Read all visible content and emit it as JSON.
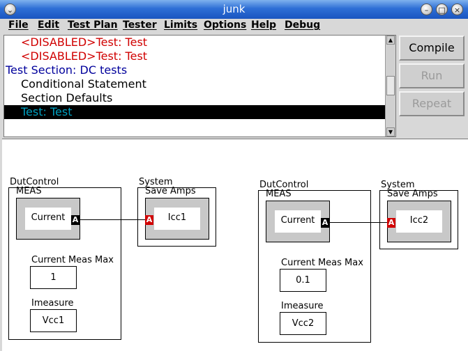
{
  "window": {
    "title": "junk"
  },
  "menu": [
    "File",
    "Edit",
    "Test Plan",
    "Tester",
    "Limits",
    "Options",
    "Help",
    "Debug"
  ],
  "list": [
    {
      "text": "<DISABLED>Test: Test",
      "color": "#d00000"
    },
    {
      "text": "<DISABLED>Test: Test",
      "color": "#d00000"
    },
    {
      "text": "Test Section: DC tests",
      "color": "#00009c"
    },
    {
      "text": "Conditional Statement",
      "color": "#000000"
    },
    {
      "text": "Section Defaults",
      "color": "#000000"
    },
    {
      "text": "Test: Test",
      "color": "#00a0c0",
      "selected": true
    }
  ],
  "buttons": {
    "compile": "Compile",
    "run": "Run",
    "repeat": "Repeat"
  },
  "diagram": {
    "left": {
      "dut_title": "DutControl",
      "dut_sub": "MEAS",
      "current": "Current",
      "port_out": "A",
      "sys_title": "System",
      "sys_sub": "Save Amps",
      "port_in": "A",
      "target": "Icc1",
      "max_label": "Current Meas Max",
      "max_value": "1",
      "imeasure_label": "Imeasure",
      "imeasure_value": "Vcc1"
    },
    "right": {
      "dut_title": "DutControl",
      "dut_sub": "MEAS",
      "current": "Current",
      "port_out": "A",
      "sys_title": "System",
      "sys_sub": "Save Amps",
      "port_in": "A",
      "target": "Icc2",
      "max_label": "Current Meas Max",
      "max_value": "0.1",
      "imeasure_label": "Imeasure",
      "imeasure_value": "Vcc2"
    }
  }
}
